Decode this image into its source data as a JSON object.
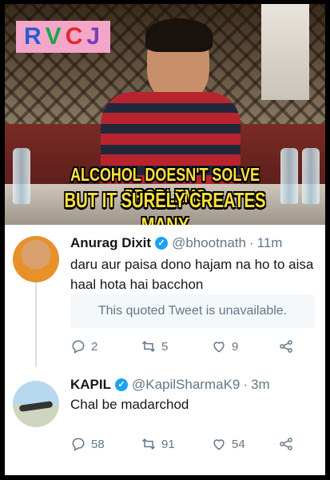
{
  "logo": {
    "letters": [
      "R",
      "V",
      "C",
      "J"
    ],
    "colors": [
      "#2a5bd7",
      "#17a84a",
      "#e0282e",
      "#7a3fb5"
    ]
  },
  "meme": {
    "line1": "ALCOHOL DOESN'T SOLVE PROBLEMS",
    "line2": "BUT IT SURELY CREATES MANY"
  },
  "tweets": [
    {
      "name": "Anurag Dixit",
      "handle": "@bhootnath",
      "time": "11m",
      "text": "daru aur paisa dono hajam na ho to aisa haal hota hai bacchon",
      "quoted": "This quoted Tweet is unavailable.",
      "replies": "2",
      "retweets": "5",
      "likes": "9"
    },
    {
      "name": "KAPIL",
      "handle": "@KapilSharmaK9",
      "time": "3m",
      "text": "Chal be madarchod",
      "replies": "58",
      "retweets": "91",
      "likes": "54"
    }
  ],
  "colors": {
    "verified": "#1da1f2",
    "caption": "#ffe23a",
    "meta": "#657786"
  }
}
